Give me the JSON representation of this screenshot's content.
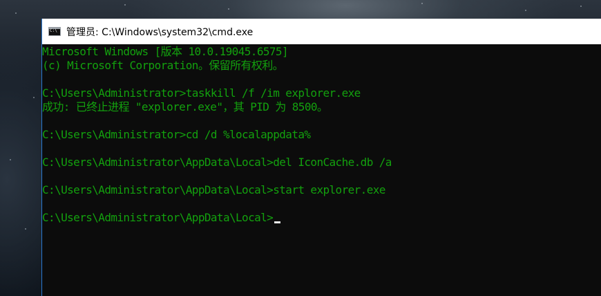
{
  "window": {
    "title": "管理员: C:\\Windows\\system32\\cmd.exe",
    "icon": "cmd-icon"
  },
  "console": {
    "text_color": "#13a10e",
    "background": "#0c0c0c",
    "lines": [
      "Microsoft Windows [版本 10.0.19045.6575]",
      "(c) Microsoft Corporation。保留所有权利。",
      "",
      "C:\\Users\\Administrator>taskkill /f /im explorer.exe",
      "成功: 已终止进程 \"explorer.exe\"，其 PID 为 8500。",
      "",
      "C:\\Users\\Administrator>cd /d %localappdata%",
      "",
      "C:\\Users\\Administrator\\AppData\\Local>del IconCache.db /a",
      "",
      "C:\\Users\\Administrator\\AppData\\Local>start explorer.exe",
      "",
      "C:\\Users\\Administrator\\AppData\\Local>"
    ]
  }
}
